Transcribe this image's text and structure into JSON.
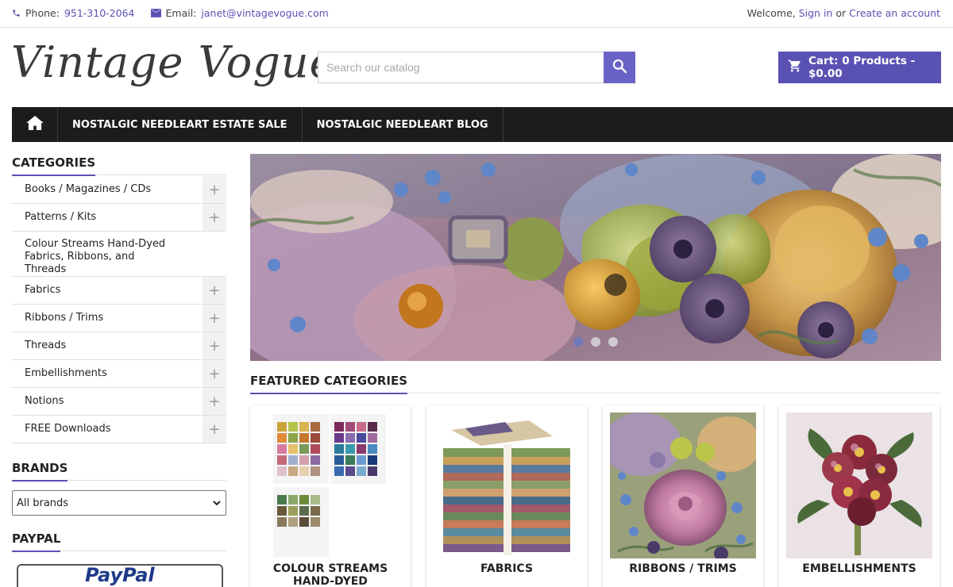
{
  "topbar": {
    "phone_label": "Phone:",
    "phone": "951-310-2064",
    "email_label": "Email:",
    "email": "janet@vintagevogue.com",
    "welcome": "Welcome,",
    "sign_in": "Sign in",
    "or": "or",
    "create_account": "Create an account"
  },
  "header": {
    "logo": "Vintage Vogue",
    "search_placeholder": "Search our catalog",
    "cart": "Cart: 0 Products - $0.00"
  },
  "nav": {
    "items": [
      "NOSTALGIC NEEDLEART ESTATE SALE",
      "NOSTALGIC NEEDLEART BLOG"
    ]
  },
  "sidebar": {
    "categories_title": "CATEGORIES",
    "categories": [
      {
        "label": "Books / Magazines / CDs",
        "expandable": true
      },
      {
        "label": "Patterns / Kits",
        "expandable": true
      },
      {
        "label": "Colour Streams Hand-Dyed Fabrics, Ribbons, and Threads",
        "expandable": false
      },
      {
        "label": "Fabrics",
        "expandable": true
      },
      {
        "label": "Ribbons / Trims",
        "expandable": true
      },
      {
        "label": "Threads",
        "expandable": true
      },
      {
        "label": "Embellishments",
        "expandable": true
      },
      {
        "label": "Notions",
        "expandable": true
      },
      {
        "label": "FREE Downloads",
        "expandable": true
      }
    ],
    "brands_title": "BRANDS",
    "brands_selected": "All brands",
    "paypal_title": "PAYPAL",
    "paypal_logo": "PayPal"
  },
  "slider": {
    "slides": 3,
    "active": 1
  },
  "featured": {
    "title": "FEATURED CATEGORIES",
    "cards": [
      {
        "name": "COLOUR STREAMS HAND-DYED FABRICS,"
      },
      {
        "name": "FABRICS"
      },
      {
        "name": "RIBBONS / TRIMS"
      },
      {
        "name": "EMBELLISHMENTS"
      }
    ]
  },
  "colors": {
    "accent": "#5a52b3",
    "nav_bg": "#1c1c1c"
  },
  "icons": [
    "phone-icon",
    "email-icon",
    "search-icon",
    "cart-icon",
    "home-icon",
    "plus-icon",
    "chevron-down-icon"
  ]
}
